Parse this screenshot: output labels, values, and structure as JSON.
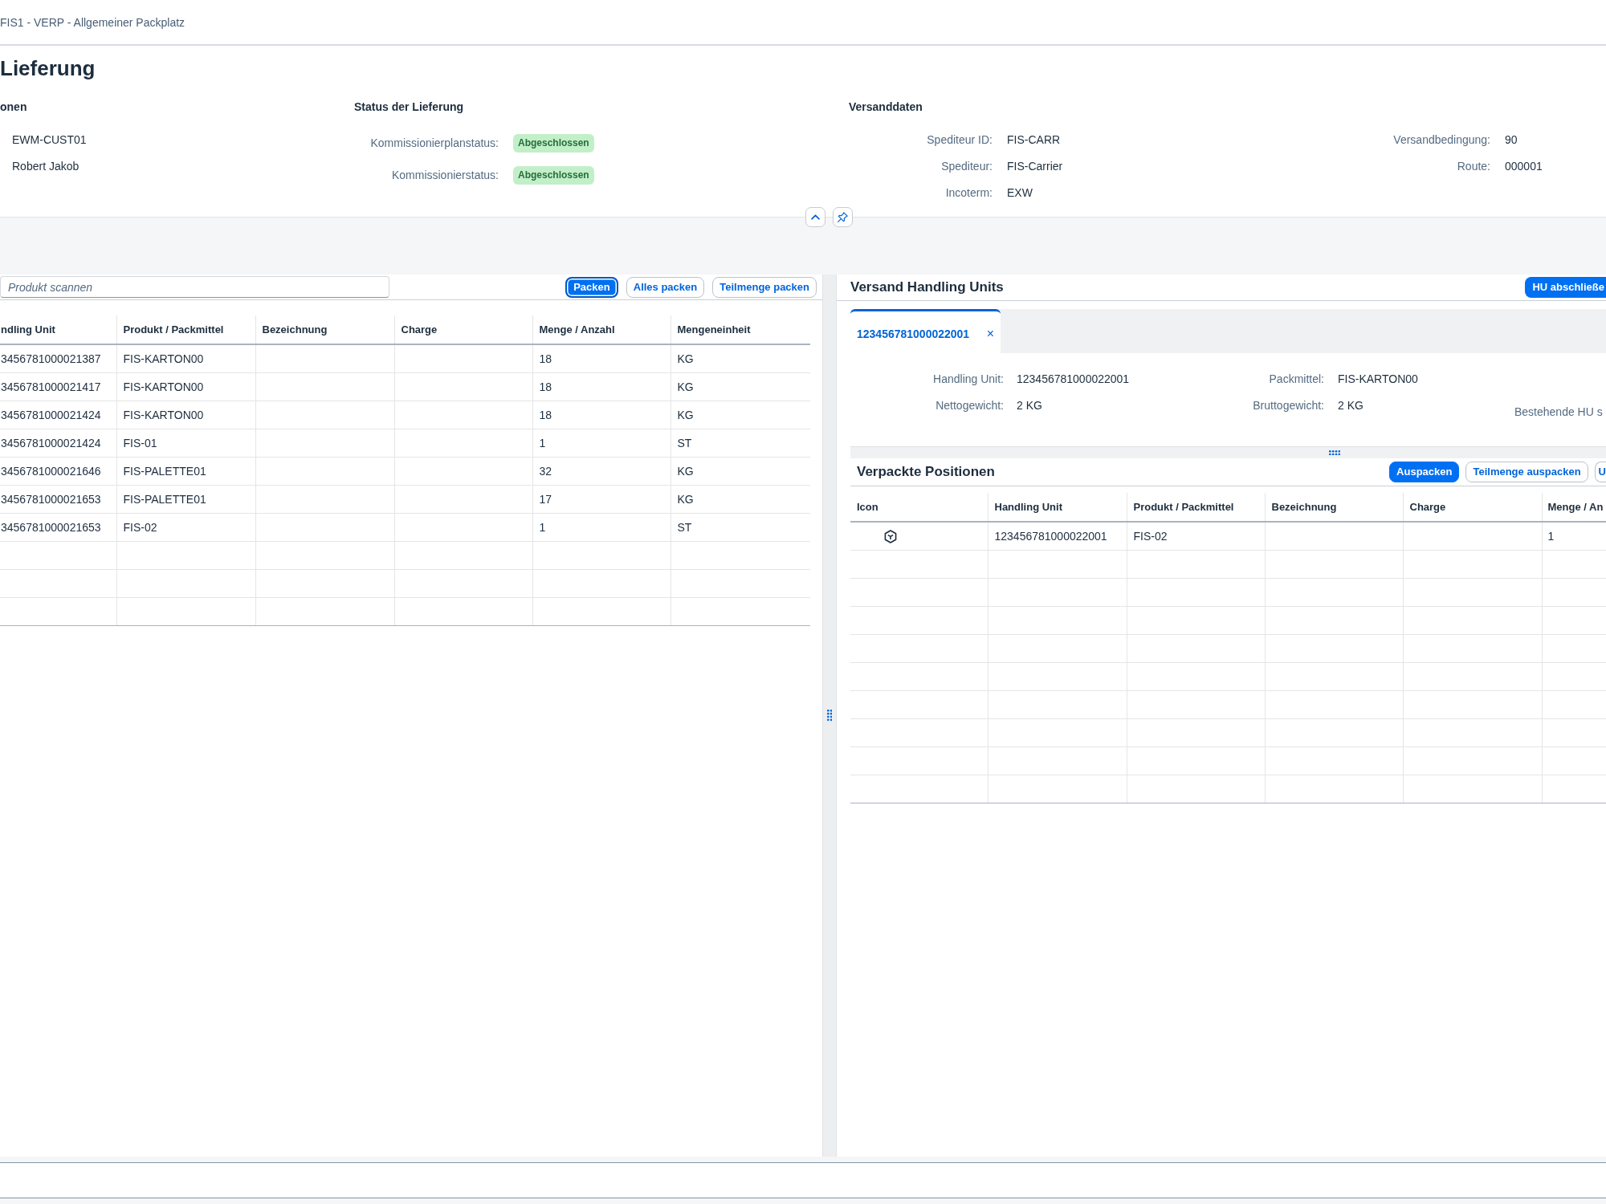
{
  "shell": {
    "title": "FIS1 - VERP - Allgemeiner Packplatz"
  },
  "header": {
    "title": "Lieferung",
    "sections": [
      {
        "title": "onen",
        "columns": [
          [
            {
              "kind": "text",
              "value": "EWM-CUST01"
            },
            {
              "kind": "text",
              "value": "Robert Jakob"
            }
          ]
        ]
      },
      {
        "title": "Status der Lieferung",
        "columns": [
          [
            {
              "kind": "status",
              "label": "Kommissionierplanstatus:",
              "value": "Abgeschlossen",
              "success": true
            },
            {
              "kind": "status",
              "label": "Kommissionierstatus:",
              "value": "Abgeschlossen",
              "success": true
            }
          ]
        ]
      },
      {
        "title": "Versanddaten",
        "columns": [
          [
            {
              "kind": "text",
              "label": "Spediteur ID:",
              "value": "FIS-CARR"
            },
            {
              "kind": "text",
              "label": "Spediteur:",
              "value": "FIS-Carrier"
            },
            {
              "kind": "text",
              "label": "Incoterm:",
              "value": "EXW"
            }
          ],
          [
            {
              "kind": "text",
              "label": "Versandbedingung:",
              "value": "90"
            },
            {
              "kind": "text",
              "label": "Route:",
              "value": "000001"
            }
          ]
        ]
      }
    ]
  },
  "packing": {
    "scan_field": {
      "placeholder": "Produkt scannen"
    },
    "actions": [
      {
        "label": "Packen",
        "emphasized": true,
        "focused": true
      },
      {
        "label": "Alles packen",
        "emphasized": false,
        "focused": false
      },
      {
        "label": "Teilmenge packen",
        "emphasized": false,
        "focused": false
      }
    ],
    "table": {
      "columns": {
        "handling_unit": "ndling Unit",
        "product": "Produkt / Packmittel",
        "description": "Bezeichnung",
        "batch": "Charge",
        "quantity": "Menge / Anzahl",
        "unit": "Mengeneinheit"
      },
      "rows": [
        {
          "handling_unit": "3456781000021387",
          "product": "FIS-KARTON00",
          "quantity": "18",
          "unit": "KG"
        },
        {
          "handling_unit": "3456781000021417",
          "product": "FIS-KARTON00",
          "quantity": "18",
          "unit": "KG"
        },
        {
          "handling_unit": "3456781000021424",
          "product": "FIS-KARTON00",
          "quantity": "18",
          "unit": "KG"
        },
        {
          "handling_unit": "3456781000021424",
          "product": "FIS-01",
          "quantity": "1",
          "unit": "ST"
        },
        {
          "handling_unit": "3456781000021646",
          "product": "FIS-PALETTE01",
          "quantity": "32",
          "unit": "KG"
        },
        {
          "handling_unit": "3456781000021653",
          "product": "FIS-PALETTE01",
          "quantity": "17",
          "unit": "KG"
        },
        {
          "handling_unit": "3456781000021653",
          "product": "FIS-02",
          "quantity": "1",
          "unit": "ST"
        }
      ]
    }
  },
  "handling_units": {
    "title": "Versand Handling Units",
    "actions": [
      {
        "label": "HU abschließe",
        "emphasized": true
      }
    ],
    "tabs": [
      {
        "label": "123456781000022001",
        "close": "×",
        "selected": true
      }
    ],
    "details": {
      "columns": [
        [
          {
            "label": "Handling Unit:",
            "value": "123456781000022001"
          },
          {
            "label": "Nettogewicht:",
            "value": "2 KG"
          }
        ],
        [
          {
            "label": "Packmittel:",
            "value": "FIS-KARTON00"
          },
          {
            "label": "Bruttogewicht:",
            "value": "2 KG"
          }
        ],
        [
          {
            "label": "Bestehende HU s"
          }
        ]
      ]
    },
    "packed_items": {
      "title": "Verpackte Positionen",
      "actions": [
        {
          "label": "Auspacken",
          "emphasized": true
        },
        {
          "label": "Teilmenge auspacken",
          "emphasized": false
        },
        {
          "label": "U",
          "emphasized": false
        }
      ],
      "table": {
        "columns": {
          "icon": "Icon",
          "handling_unit": "Handling Unit",
          "product": "Produkt / Packmittel",
          "description": "Bezeichnung",
          "batch": "Charge",
          "quantity": "Menge / An"
        },
        "rows": [
          {
            "handling_unit": "123456781000022001",
            "product": "FIS-02",
            "quantity": "1"
          }
        ]
      }
    }
  }
}
